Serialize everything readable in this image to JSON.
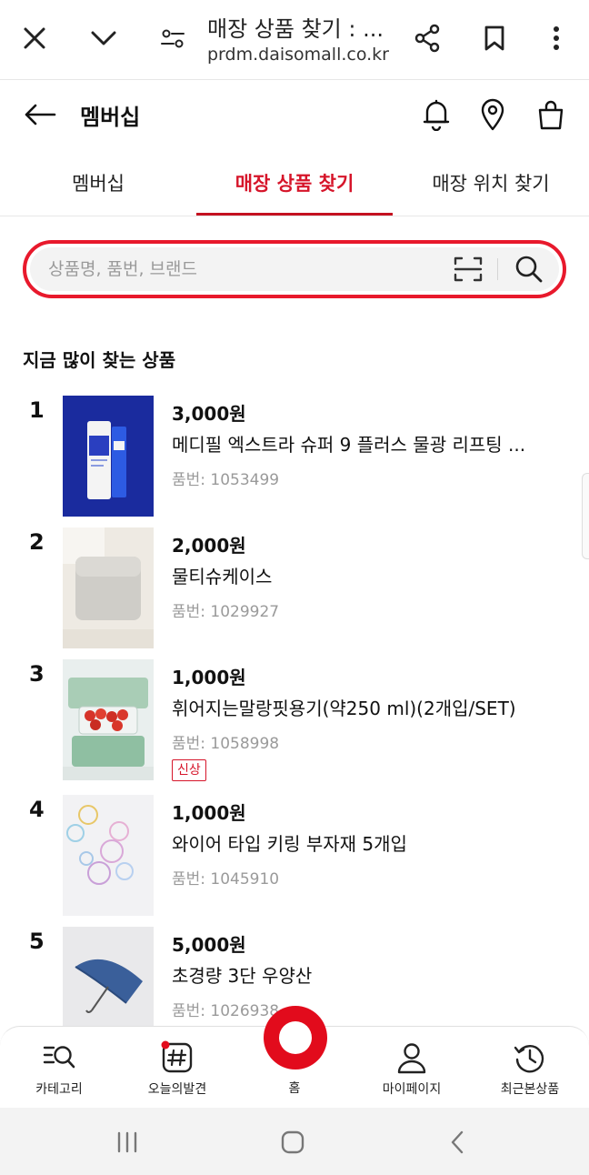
{
  "browser": {
    "title": "매장 상품 찾기 : ...",
    "url": "prdm.daisomall.co.kr"
  },
  "header": {
    "title": "멤버십"
  },
  "tabs": [
    {
      "label": "멤버십"
    },
    {
      "label": "매장 상품 찾기"
    },
    {
      "label": "매장 위치 찾기"
    }
  ],
  "search": {
    "placeholder": "상품명, 품번, 브랜드",
    "value": ""
  },
  "section": {
    "title": "지금 많이 찾는 상품"
  },
  "products": [
    {
      "rank": "1",
      "price": "3,000원",
      "name": "메디필 엑스트라 슈퍼 9 플러스 물광 리프팅 ...",
      "code": "품번: 1053499",
      "badge": ""
    },
    {
      "rank": "2",
      "price": "2,000원",
      "name": "물티슈케이스",
      "code": "품번: 1029927",
      "badge": ""
    },
    {
      "rank": "3",
      "price": "1,000원",
      "name": "휘어지는말랑핏용기(약250 ml)(2개입/SET)",
      "code": "품번: 1058998",
      "badge": "신상"
    },
    {
      "rank": "4",
      "price": "1,000원",
      "name": "와이어 타입 키링 부자재 5개입",
      "code": "품번: 1045910",
      "badge": ""
    },
    {
      "rank": "5",
      "price": "5,000원",
      "name": "초경량 3단 우양산",
      "code": "품번: 1026938",
      "badge": ""
    }
  ],
  "bottom_nav": [
    {
      "label": "카테고리",
      "icon": "category-search-icon"
    },
    {
      "label": "오늘의발견",
      "icon": "hashtag-icon"
    },
    {
      "label": "홈",
      "icon": "home-ring-icon"
    },
    {
      "label": "마이페이지",
      "icon": "person-icon"
    },
    {
      "label": "최근본상품",
      "icon": "history-icon"
    }
  ],
  "colors": {
    "accent": "#d6152a",
    "search_border": "#e8192c",
    "home_ring": "#e20b1c"
  }
}
